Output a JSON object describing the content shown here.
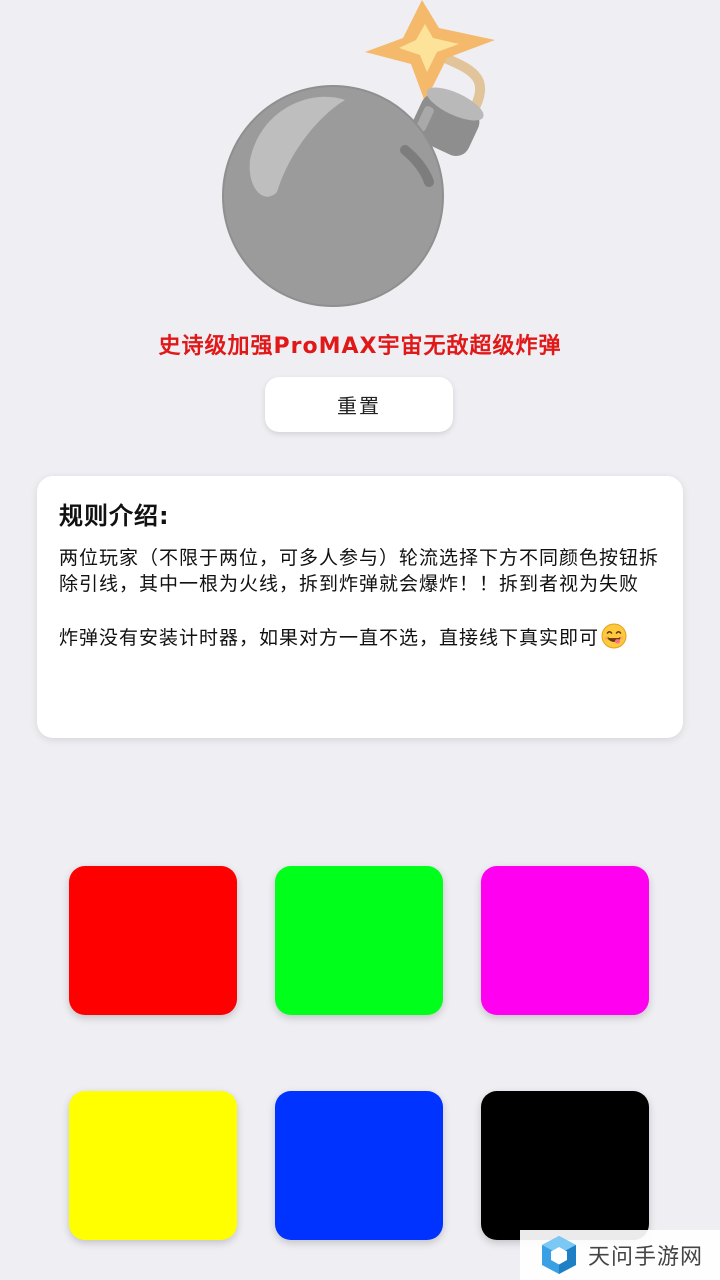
{
  "header": {
    "title": "史诗级加强ProMAX宇宙无敌超级炸弹"
  },
  "reset_button": {
    "label": "重置"
  },
  "rules": {
    "title": "规则介绍:",
    "paragraph1": "两位玩家（不限于两位，可多人参与）轮流选择下方不同颜色按钮拆除引线，其中一根为火线，拆到炸弹就会爆炸！！拆到者视为失败",
    "paragraph2": "炸弹没有安装计时器，如果对方一直不选，直接线下真实即可",
    "emoji": "yum-face"
  },
  "wires": [
    {
      "name": "red",
      "color": "#ff0000"
    },
    {
      "name": "green",
      "color": "#00ff1a"
    },
    {
      "name": "magenta",
      "color": "#ff00f0"
    },
    {
      "name": "yellow",
      "color": "#ffff00"
    },
    {
      "name": "blue",
      "color": "#0033ff"
    },
    {
      "name": "black",
      "color": "#000000"
    }
  ],
  "icons": {
    "bomb": "bomb-icon"
  },
  "watermark": {
    "text": "天问手游网"
  },
  "colors": {
    "background": "#eeeef3",
    "title": "#e01818"
  }
}
